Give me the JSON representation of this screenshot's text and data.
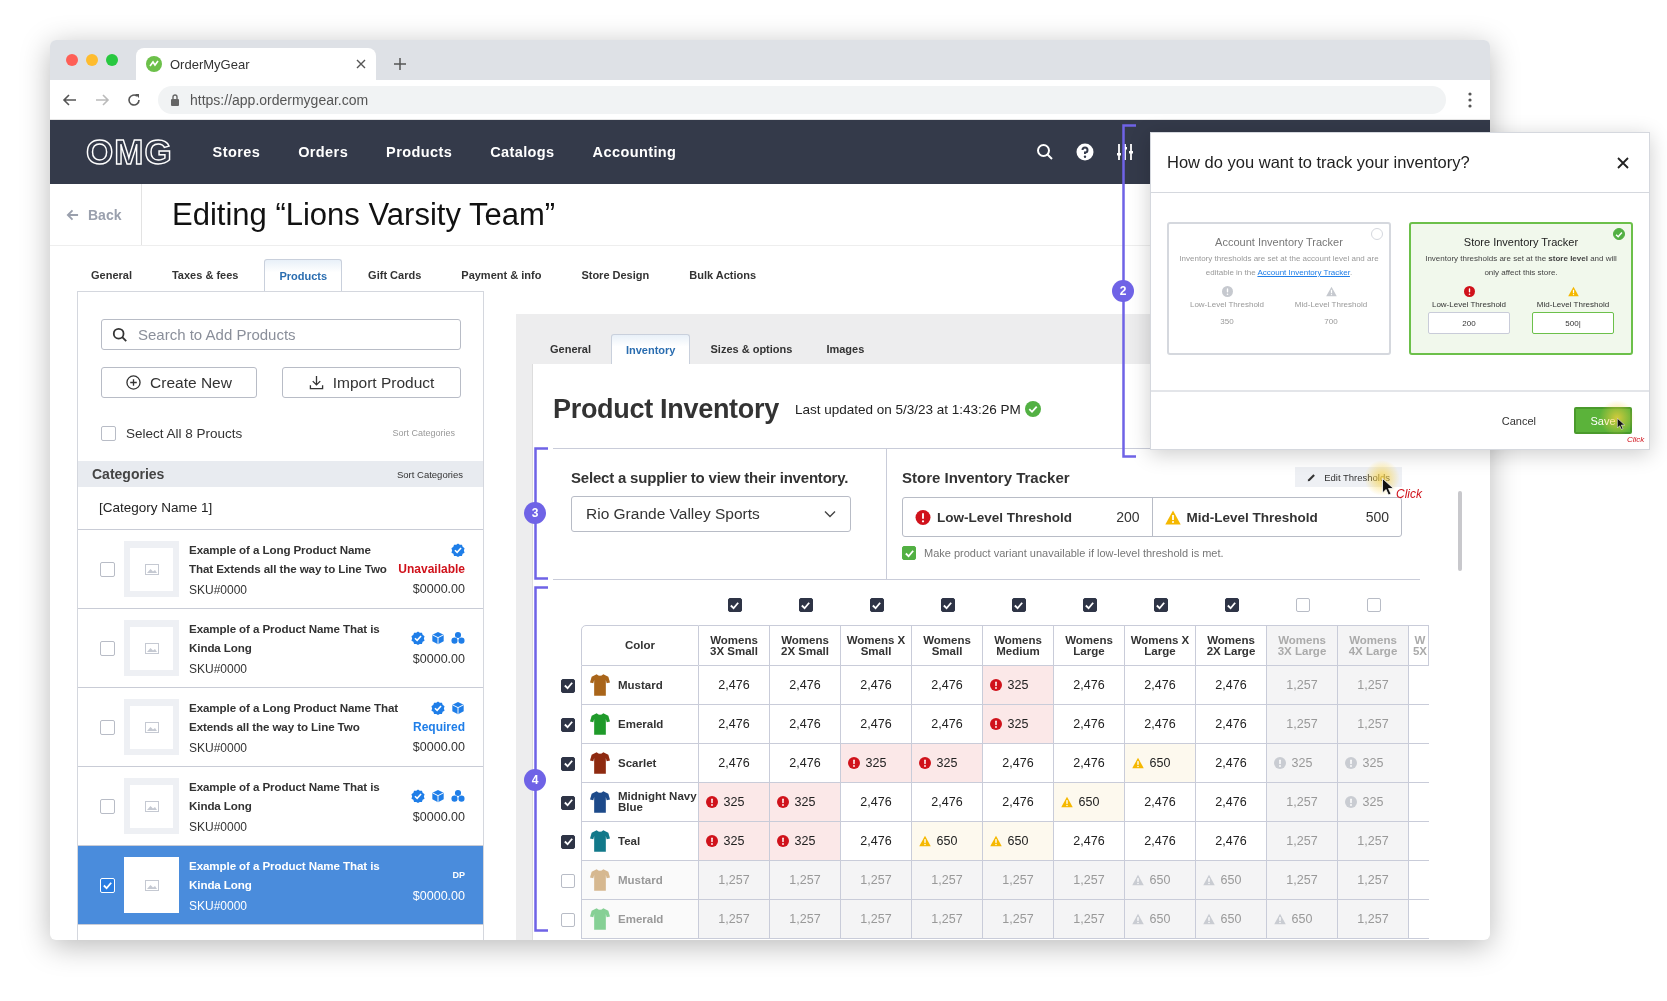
{
  "browser": {
    "tab_title": "OrderMyGear",
    "url": "https://app.ordermygear.com"
  },
  "nav": {
    "logo": "OMG",
    "items": [
      "Stores",
      "Orders",
      "Products",
      "Catalogs",
      "Accounting"
    ]
  },
  "page": {
    "back": "Back",
    "title": "Editing “Lions Varsity Team”"
  },
  "tabs": [
    {
      "label": "General",
      "selected": false
    },
    {
      "label": "Taxes & fees",
      "selected": false
    },
    {
      "label": "Products",
      "selected": true
    },
    {
      "label": "Gift Cards",
      "selected": false
    },
    {
      "label": "Payment & info",
      "selected": false
    },
    {
      "label": "Store Design",
      "selected": false
    },
    {
      "label": "Bulk Actions",
      "selected": false
    }
  ],
  "left_panel": {
    "search_placeholder": "Search to Add Products",
    "create_button": "Create New",
    "import_button": "Import Product",
    "select_all": {
      "label": "Select All 8 Proucts",
      "checked": false
    },
    "sort_link": "Sort Categories",
    "categories_header": "Categories",
    "categories_sort": "Sort Categories",
    "category_name": "[Category Name 1]",
    "products": [
      {
        "name": "Example of a Long Product Name That Extends all the way to Line Two",
        "sku": "SKU#0000",
        "price": "$0000.00",
        "badges": [
          {
            "kind": "check"
          }
        ],
        "status": {
          "text": "Unavailable",
          "kind": "error"
        },
        "checked": false,
        "selected": false
      },
      {
        "name": "Example of a Product Name That is Kinda Long",
        "sku": "SKU#0000",
        "price": "$0000.00",
        "badges": [
          {
            "kind": "check"
          },
          {
            "kind": "box"
          },
          {
            "kind": "cluster"
          }
        ],
        "checked": false,
        "selected": false
      },
      {
        "name": "Example of a Long Product Name That Extends all the way to Line Two",
        "sku": "SKU#0000",
        "price": "$0000.00",
        "badges": [
          {
            "kind": "check"
          },
          {
            "kind": "box"
          }
        ],
        "status": {
          "text": "Required",
          "kind": "info"
        },
        "checked": false,
        "selected": false
      },
      {
        "name": "Example of a Product Name That is Kinda Long",
        "sku": "SKU#0000",
        "price": "$0000.00",
        "badges": [
          {
            "kind": "check"
          },
          {
            "kind": "box"
          },
          {
            "kind": "cluster"
          }
        ],
        "checked": false,
        "selected": false
      },
      {
        "name": "Example of a Product Name That is Kinda Long",
        "sku": "SKU#0000",
        "price": "$0000.00",
        "tag": "DP",
        "checked": true,
        "selected": true
      }
    ]
  },
  "product_tabs": [
    {
      "label": "General",
      "selected": false
    },
    {
      "label": "Inventory",
      "selected": true
    },
    {
      "label": "Sizes & options",
      "selected": false
    },
    {
      "label": "Images",
      "selected": false
    }
  ],
  "inventory": {
    "title": "Product Inventory",
    "last_updated": "Last updated on 5/3/23 at 1:43:26 PM",
    "supplier": {
      "label": "Select a supplier to view their inventory.",
      "value": "Rio Grande Valley Sports"
    },
    "tracker": {
      "title": "Store Inventory Tracker",
      "edit_button": "Edit Thresholds",
      "low": {
        "label": "Low-Level Threshold",
        "value": "200"
      },
      "mid": {
        "label": "Mid-Level Threshold",
        "value": "500"
      },
      "unavailable_option": {
        "label": "Make product variant unavailable if low-level threshold is met.",
        "checked": true
      }
    },
    "table": {
      "color_header": "Color",
      "cut_column": "W 5X",
      "sizes": [
        {
          "label": "Womens 3X Small",
          "checked": true
        },
        {
          "label": "Womens 2X Small",
          "checked": true
        },
        {
          "label": "Womens X Small",
          "checked": true
        },
        {
          "label": "Womens Small",
          "checked": true
        },
        {
          "label": "Womens Medium",
          "checked": true
        },
        {
          "label": "Womens Large",
          "checked": true
        },
        {
          "label": "Womens X Large",
          "checked": true
        },
        {
          "label": "Womens 2X Large",
          "checked": true
        },
        {
          "label": "Womens 3X Large",
          "checked": false
        },
        {
          "label": "Womens 4X Large",
          "checked": false
        }
      ],
      "rows": [
        {
          "name": "Mustard",
          "color": "#a9651a",
          "checked": true,
          "cells": [
            {
              "value": "2,476",
              "kind": "normal"
            },
            {
              "value": "2,476",
              "kind": "normal"
            },
            {
              "value": "2,476",
              "kind": "normal"
            },
            {
              "value": "2,476",
              "kind": "normal"
            },
            {
              "value": "325",
              "kind": "low"
            },
            {
              "value": "2,476",
              "kind": "normal"
            },
            {
              "value": "2,476",
              "kind": "normal"
            },
            {
              "value": "2,476",
              "kind": "normal"
            },
            {
              "value": "1,257",
              "kind": "normal"
            },
            {
              "value": "1,257",
              "kind": "normal"
            }
          ]
        },
        {
          "name": "Emerald",
          "color": "#1f9a2a",
          "checked": true,
          "cells": [
            {
              "value": "2,476",
              "kind": "normal"
            },
            {
              "value": "2,476",
              "kind": "normal"
            },
            {
              "value": "2,476",
              "kind": "normal"
            },
            {
              "value": "2,476",
              "kind": "normal"
            },
            {
              "value": "325",
              "kind": "low"
            },
            {
              "value": "2,476",
              "kind": "normal"
            },
            {
              "value": "2,476",
              "kind": "normal"
            },
            {
              "value": "2,476",
              "kind": "normal"
            },
            {
              "value": "1,257",
              "kind": "normal"
            },
            {
              "value": "1,257",
              "kind": "normal"
            }
          ]
        },
        {
          "name": "Scarlet",
          "color": "#8e2a10",
          "checked": true,
          "cells": [
            {
              "value": "2,476",
              "kind": "normal"
            },
            {
              "value": "2,476",
              "kind": "normal"
            },
            {
              "value": "325",
              "kind": "low"
            },
            {
              "value": "325",
              "kind": "low"
            },
            {
              "value": "2,476",
              "kind": "normal"
            },
            {
              "value": "2,476",
              "kind": "normal"
            },
            {
              "value": "650",
              "kind": "mid"
            },
            {
              "value": "2,476",
              "kind": "normal"
            },
            {
              "value": "325",
              "kind": "low"
            },
            {
              "value": "325",
              "kind": "low"
            }
          ]
        },
        {
          "name": "Midnight Navy Blue",
          "color": "#1d4a8a",
          "checked": true,
          "cells": [
            {
              "value": "325",
              "kind": "low"
            },
            {
              "value": "325",
              "kind": "low"
            },
            {
              "value": "2,476",
              "kind": "normal"
            },
            {
              "value": "2,476",
              "kind": "normal"
            },
            {
              "value": "2,476",
              "kind": "normal"
            },
            {
              "value": "650",
              "kind": "mid"
            },
            {
              "value": "2,476",
              "kind": "normal"
            },
            {
              "value": "2,476",
              "kind": "normal"
            },
            {
              "value": "1,257",
              "kind": "normal"
            },
            {
              "value": "325",
              "kind": "low"
            }
          ]
        },
        {
          "name": "Teal",
          "color": "#12798a",
          "checked": true,
          "cells": [
            {
              "value": "325",
              "kind": "low"
            },
            {
              "value": "325",
              "kind": "low"
            },
            {
              "value": "2,476",
              "kind": "normal"
            },
            {
              "value": "650",
              "kind": "mid"
            },
            {
              "value": "650",
              "kind": "mid"
            },
            {
              "value": "2,476",
              "kind": "normal"
            },
            {
              "value": "2,476",
              "kind": "normal"
            },
            {
              "value": "2,476",
              "kind": "normal"
            },
            {
              "value": "1,257",
              "kind": "normal"
            },
            {
              "value": "1,257",
              "kind": "normal"
            }
          ]
        },
        {
          "name": "Mustard",
          "color": "#d6b890",
          "checked": false,
          "cells": [
            {
              "value": "1,257",
              "kind": "normal"
            },
            {
              "value": "1,257",
              "kind": "normal"
            },
            {
              "value": "1,257",
              "kind": "normal"
            },
            {
              "value": "1,257",
              "kind": "normal"
            },
            {
              "value": "1,257",
              "kind": "normal"
            },
            {
              "value": "1,257",
              "kind": "normal"
            },
            {
              "value": "650",
              "kind": "mid"
            },
            {
              "value": "650",
              "kind": "mid"
            },
            {
              "value": "1,257",
              "kind": "normal"
            },
            {
              "value": "1,257",
              "kind": "normal"
            }
          ]
        },
        {
          "name": "Emerald",
          "color": "#86d095",
          "checked": false,
          "cells": [
            {
              "value": "1,257",
              "kind": "normal"
            },
            {
              "value": "1,257",
              "kind": "normal"
            },
            {
              "value": "1,257",
              "kind": "normal"
            },
            {
              "value": "1,257",
              "kind": "normal"
            },
            {
              "value": "1,257",
              "kind": "normal"
            },
            {
              "value": "1,257",
              "kind": "normal"
            },
            {
              "value": "650",
              "kind": "mid"
            },
            {
              "value": "650",
              "kind": "mid"
            },
            {
              "value": "650",
              "kind": "mid"
            },
            {
              "value": "1,257",
              "kind": "normal"
            }
          ]
        }
      ]
    }
  },
  "modal": {
    "title": "How do you want to track your inventory?",
    "options": [
      {
        "title": "Account Inventory Tracker",
        "description": "Inventory thresholds are set at the account level and are editable in the ",
        "link": "Account Inventory Tracker",
        "description_end": ".",
        "selected": false,
        "low": {
          "label": "Low-Level Threshold",
          "value": "350"
        },
        "mid": {
          "label": "Mid-Level Threshold",
          "value": "700"
        }
      },
      {
        "title": "Store Inventory Tracker",
        "description": "Inventory thresholds are set at the **store level** and will only affect this store.",
        "selected": true,
        "low": {
          "label": "Low-Level Threshold",
          "value": "200"
        },
        "mid": {
          "label": "Mid-Level Threshold",
          "value": "500|"
        }
      }
    ],
    "cancel": "Cancel",
    "save": "Save"
  },
  "callouts": [
    {
      "number": "2"
    },
    {
      "number": "3"
    },
    {
      "number": "4"
    }
  ],
  "click_hints": [
    "Click",
    "Click"
  ]
}
